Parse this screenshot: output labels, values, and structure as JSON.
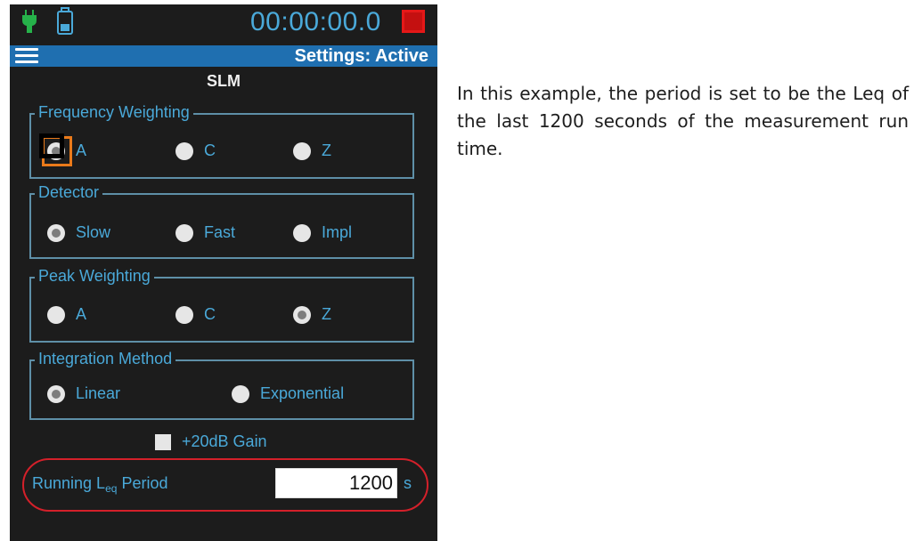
{
  "status_bar": {
    "timer": "00:00:00.0",
    "plug_icon": "power-plug-icon",
    "battery_icon": "battery-icon",
    "record_icon": "record-stop-icon",
    "colors": {
      "plug": "#26b24a",
      "timer": "#4aa9d9",
      "record": "#e51818"
    }
  },
  "title_bar": {
    "menu_icon": "hamburger-menu-icon",
    "settings_status": "Settings: Active",
    "color": "#1f6fb0"
  },
  "screen_title": "SLM",
  "frequency_weighting": {
    "legend": "Frequency Weighting",
    "options": [
      {
        "label": "A",
        "selected": true,
        "focused": true
      },
      {
        "label": "C",
        "selected": false
      },
      {
        "label": "Z",
        "selected": false
      }
    ]
  },
  "detector": {
    "legend": "Detector",
    "options": [
      {
        "label": "Slow",
        "selected": true
      },
      {
        "label": "Fast",
        "selected": false
      },
      {
        "label": "Impl",
        "selected": false
      }
    ]
  },
  "peak_weighting": {
    "legend": "Peak Weighting",
    "options": [
      {
        "label": "A",
        "selected": false
      },
      {
        "label": "C",
        "selected": false
      },
      {
        "label": "Z",
        "selected": true
      }
    ]
  },
  "integration_method": {
    "legend": "Integration Method",
    "options": [
      {
        "label": "Linear",
        "selected": true
      },
      {
        "label": "Exponential",
        "selected": false
      }
    ]
  },
  "gain": {
    "label": "+20dB Gain",
    "checked": false
  },
  "running_leq": {
    "label_prefix": "Running L",
    "label_sub": "eq",
    "label_suffix": " Period",
    "value": "1200",
    "unit": "s"
  },
  "explanation": "In this example, the period is set to be the Leq of the last 1200 seconds of the measurement run time."
}
